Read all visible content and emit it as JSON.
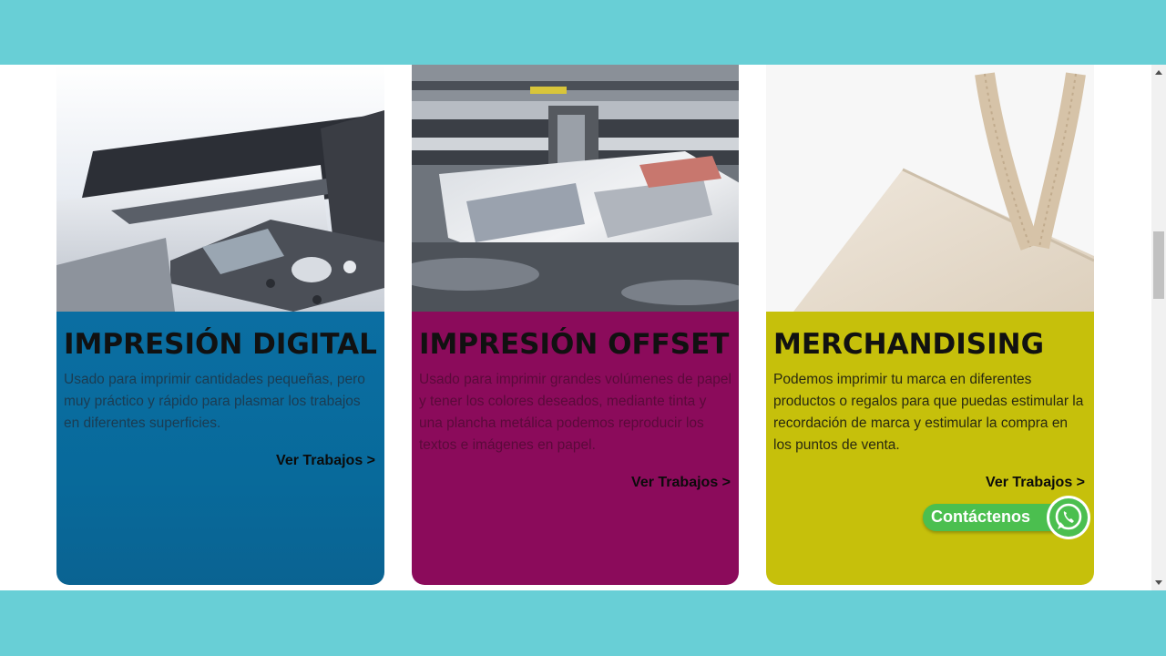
{
  "cards": [
    {
      "title": "IMPRESIÓN DIGITAL",
      "description": "Usado para imprimir cantidades pequeñas, pero muy práctico y rápido para plasmar los trabajos en diferentes superficies.",
      "link": "Ver Trabajos >",
      "color": "#0b6ea2",
      "image": "large-format-printer-photo"
    },
    {
      "title": "IMPRESIÓN OFFSET",
      "description": "Usado para imprimir grandes volúmenes de papel y tener los colores deseados, mediante tinta y una plancha metálica podemos reproducir los textos e imágenes en papel.",
      "link": "Ver Trabajos >",
      "color": "#8b0b5b",
      "image": "offset-press-photo"
    },
    {
      "title": "MERCHANDISING",
      "description": "Podemos imprimir tu marca en diferentes productos o regalos para que puedas estimular la recordación de marca y estimular la compra en los puntos de venta.",
      "link": "Ver Trabajos >",
      "color": "#c6c00b",
      "image": "tote-bag-photo"
    }
  ],
  "whatsapp": {
    "label": "Contáctenos",
    "icon": "whatsapp-icon",
    "color": "#4bbf4f"
  }
}
